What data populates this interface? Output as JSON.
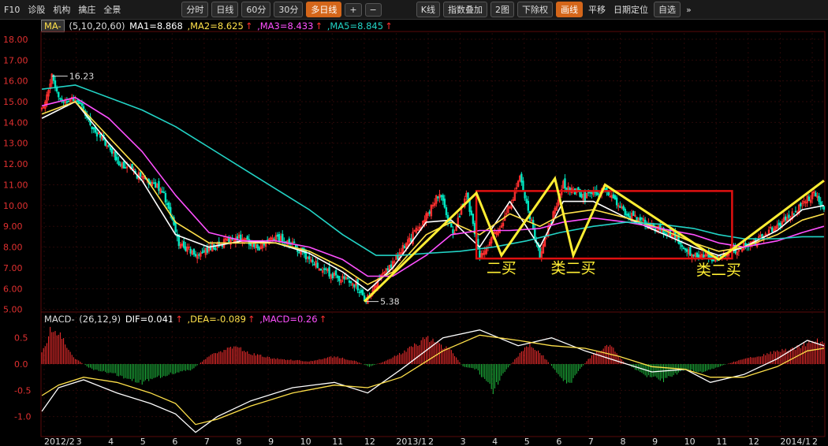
{
  "toolbar": {
    "left_items": [
      "F10",
      "诊股",
      "机构",
      "擒庄",
      "全景"
    ],
    "period_buttons": [
      "分时",
      "日线",
      "60分",
      "30分"
    ],
    "active_period": "多日线",
    "period_extra": [
      "+",
      "−"
    ],
    "right_buttons": [
      "K线",
      "指数叠加",
      "2图",
      "下除权",
      "画线"
    ],
    "right_items": [
      "平移",
      "日期定位",
      "自选"
    ],
    "far_right": "»"
  },
  "ma_legend": {
    "name": "MA-",
    "params": "(5,10,20,60)",
    "ma1": "MA1=8.868",
    "ma2": ",MA2=8.625",
    "ma3": ",MA3=8.433",
    "ma5": ",MA5=8.845",
    "arrow": "↑"
  },
  "macd_legend": {
    "name": "MACD-",
    "params": "(26,12,9)",
    "dif": "DIF=0.041",
    "dea": ",DEA=-0.089",
    "macd": ",MACD=0.26",
    "arrow": "↑"
  },
  "colors": {
    "up": "#ff3030",
    "down": "#00e5c0",
    "ma1": "#ffffff",
    "ma2": "#ffe14a",
    "ma3": "#ff50ff",
    "ma5": "#22d3c5",
    "annotation": "#ffee33",
    "box": "#e01010",
    "axis_text": "#e03030"
  },
  "chart_data": [
    {
      "type": "candlestick",
      "title": "",
      "y_ticks": [
        5.0,
        6.0,
        7.0,
        8.0,
        9.0,
        10.0,
        11.0,
        12.0,
        13.0,
        14.0,
        15.0,
        16.0,
        17.0,
        18.0
      ],
      "y_tick_labels": [
        "5.00",
        "6.00",
        "7.00",
        "8.00",
        "9.00",
        "10.00",
        "11.00",
        "12.00",
        "13.00",
        "14.00",
        "15.00",
        "16.00",
        "17.00",
        "18.00"
      ],
      "ylim": [
        4.95,
        18.3
      ],
      "x_labels": [
        "2012/2",
        "3",
        "4",
        "5",
        "6",
        "7",
        "8",
        "9",
        "10",
        "11",
        "12",
        "2013/1",
        "2",
        "3",
        "4",
        "5",
        "6",
        "7",
        "8",
        "9",
        "10",
        "11",
        "12",
        "2014/1",
        "2"
      ],
      "price_path": [
        [
          0,
          14.6
        ],
        [
          6,
          16.2
        ],
        [
          12,
          15.0
        ],
        [
          20,
          15.2
        ],
        [
          30,
          13.8
        ],
        [
          45,
          12.2
        ],
        [
          60,
          11.3
        ],
        [
          72,
          10.8
        ],
        [
          82,
          8.2
        ],
        [
          92,
          7.6
        ],
        [
          105,
          8.1
        ],
        [
          118,
          8.5
        ],
        [
          130,
          8.0
        ],
        [
          140,
          8.5
        ],
        [
          150,
          8.1
        ],
        [
          162,
          7.3
        ],
        [
          175,
          6.6
        ],
        [
          188,
          6.2
        ],
        [
          193,
          5.38
        ],
        [
          200,
          6.2
        ],
        [
          215,
          7.8
        ],
        [
          228,
          9.2
        ],
        [
          238,
          10.6
        ],
        [
          246,
          8.6
        ],
        [
          254,
          10.6
        ],
        [
          262,
          7.6
        ],
        [
          276,
          9.2
        ],
        [
          286,
          11.3
        ],
        [
          298,
          7.6
        ],
        [
          312,
          11.0
        ],
        [
          325,
          10.4
        ],
        [
          337,
          10.8
        ],
        [
          350,
          9.6
        ],
        [
          365,
          9.0
        ],
        [
          378,
          8.6
        ],
        [
          390,
          7.6
        ],
        [
          402,
          7.5
        ],
        [
          412,
          7.8
        ],
        [
          425,
          8.2
        ],
        [
          440,
          9.0
        ],
        [
          452,
          9.8
        ],
        [
          462,
          10.6
        ],
        [
          468,
          9.8
        ]
      ],
      "series": [
        {
          "name": "MA1",
          "points": [
            [
              0,
              14.2
            ],
            [
              20,
              15.0
            ],
            [
              40,
              13.0
            ],
            [
              60,
              11.2
            ],
            [
              80,
              8.6
            ],
            [
              100,
              8.0
            ],
            [
              120,
              8.3
            ],
            [
              140,
              8.2
            ],
            [
              160,
              7.7
            ],
            [
              180,
              6.8
            ],
            [
              195,
              5.9
            ],
            [
              210,
              7.0
            ],
            [
              230,
              9.2
            ],
            [
              245,
              9.3
            ],
            [
              262,
              8.0
            ],
            [
              280,
              10.2
            ],
            [
              298,
              8.0
            ],
            [
              312,
              10.2
            ],
            [
              330,
              10.2
            ],
            [
              350,
              9.4
            ],
            [
              370,
              8.7
            ],
            [
              390,
              8.0
            ],
            [
              405,
              7.6
            ],
            [
              420,
              8.0
            ],
            [
              440,
              8.8
            ],
            [
              455,
              9.8
            ],
            [
              468,
              10.0
            ]
          ]
        },
        {
          "name": "MA2",
          "points": [
            [
              0,
              14.4
            ],
            [
              20,
              15.0
            ],
            [
              40,
              13.3
            ],
            [
              60,
              11.6
            ],
            [
              80,
              9.2
            ],
            [
              100,
              8.2
            ],
            [
              120,
              8.2
            ],
            [
              140,
              8.2
            ],
            [
              160,
              7.8
            ],
            [
              180,
              7.0
            ],
            [
              195,
              6.2
            ],
            [
              210,
              6.8
            ],
            [
              230,
              8.6
            ],
            [
              245,
              9.2
            ],
            [
              262,
              8.6
            ],
            [
              280,
              9.6
            ],
            [
              298,
              9.0
            ],
            [
              312,
              9.6
            ],
            [
              330,
              9.8
            ],
            [
              350,
              9.4
            ],
            [
              370,
              8.9
            ],
            [
              390,
              8.2
            ],
            [
              405,
              7.8
            ],
            [
              420,
              8.0
            ],
            [
              440,
              8.6
            ],
            [
              455,
              9.3
            ],
            [
              468,
              9.6
            ]
          ]
        },
        {
          "name": "MA3",
          "points": [
            [
              0,
              14.8
            ],
            [
              20,
              15.2
            ],
            [
              40,
              14.2
            ],
            [
              60,
              12.6
            ],
            [
              80,
              10.5
            ],
            [
              100,
              8.7
            ],
            [
              120,
              8.3
            ],
            [
              140,
              8.3
            ],
            [
              160,
              8.0
            ],
            [
              180,
              7.4
            ],
            [
              195,
              6.6
            ],
            [
              210,
              6.6
            ],
            [
              230,
              7.6
            ],
            [
              245,
              8.6
            ],
            [
              262,
              8.8
            ],
            [
              280,
              8.8
            ],
            [
              298,
              8.9
            ],
            [
              312,
              9.2
            ],
            [
              330,
              9.4
            ],
            [
              350,
              9.2
            ],
            [
              370,
              8.9
            ],
            [
              390,
              8.6
            ],
            [
              405,
              8.2
            ],
            [
              420,
              8.0
            ],
            [
              440,
              8.3
            ],
            [
              455,
              8.7
            ],
            [
              468,
              9.0
            ]
          ]
        },
        {
          "name": "MA5",
          "points": [
            [
              0,
              15.6
            ],
            [
              20,
              15.8
            ],
            [
              40,
              15.2
            ],
            [
              60,
              14.6
            ],
            [
              80,
              13.8
            ],
            [
              100,
              12.8
            ],
            [
              120,
              11.8
            ],
            [
              140,
              10.8
            ],
            [
              160,
              9.8
            ],
            [
              180,
              8.6
            ],
            [
              200,
              7.6
            ],
            [
              215,
              7.6
            ],
            [
              230,
              7.7
            ],
            [
              250,
              7.8
            ],
            [
              270,
              8.0
            ],
            [
              290,
              8.3
            ],
            [
              310,
              8.7
            ],
            [
              330,
              9.0
            ],
            [
              350,
              9.2
            ],
            [
              370,
              9.1
            ],
            [
              390,
              8.9
            ],
            [
              405,
              8.6
            ],
            [
              420,
              8.4
            ],
            [
              440,
              8.4
            ],
            [
              455,
              8.5
            ],
            [
              468,
              8.5
            ]
          ]
        }
      ],
      "annotations": {
        "high_label": "16.23",
        "high_value": 16.23,
        "low_label": "5.38",
        "low_value": 5.38,
        "zigzag": [
          [
            193,
            5.38
          ],
          [
            260,
            10.6
          ],
          [
            275,
            7.6
          ],
          [
            307,
            11.3
          ],
          [
            318,
            7.6
          ],
          [
            337,
            11.0
          ],
          [
            405,
            7.4
          ],
          [
            468,
            11.2
          ]
        ],
        "box": {
          "x1": 260,
          "x2": 413,
          "y_high": 10.7,
          "y_low": 7.45
        },
        "texts": [
          {
            "text": "二买",
            "x": 275,
            "y": 6.75
          },
          {
            "text": "类二买",
            "x": 318,
            "y": 6.75
          },
          {
            "text": "类二买",
            "x": 405,
            "y": 6.65
          }
        ]
      }
    },
    {
      "type": "macd",
      "title": "",
      "y_ticks": [
        0.5,
        0.0,
        -0.5,
        -1.0
      ],
      "y_tick_labels": [
        "0.5",
        "0.0",
        "-0.5",
        "-1.0"
      ],
      "ylim": [
        -1.35,
        0.75
      ],
      "series": [
        {
          "name": "DIF",
          "points": [
            [
              0,
              -0.9
            ],
            [
              10,
              -0.45
            ],
            [
              25,
              -0.3
            ],
            [
              45,
              -0.55
            ],
            [
              65,
              -0.75
            ],
            [
              80,
              -0.95
            ],
            [
              92,
              -1.3
            ],
            [
              105,
              -1.0
            ],
            [
              125,
              -0.7
            ],
            [
              150,
              -0.45
            ],
            [
              175,
              -0.35
            ],
            [
              195,
              -0.55
            ],
            [
              215,
              -0.1
            ],
            [
              240,
              0.5
            ],
            [
              262,
              0.65
            ],
            [
              285,
              0.35
            ],
            [
              305,
              0.5
            ],
            [
              325,
              0.25
            ],
            [
              345,
              0.05
            ],
            [
              365,
              -0.15
            ],
            [
              385,
              -0.1
            ],
            [
              400,
              -0.35
            ],
            [
              420,
              -0.2
            ],
            [
              440,
              0.1
            ],
            [
              458,
              0.45
            ],
            [
              468,
              0.35
            ]
          ]
        },
        {
          "name": "DEA",
          "points": [
            [
              0,
              -0.6
            ],
            [
              10,
              -0.4
            ],
            [
              25,
              -0.25
            ],
            [
              45,
              -0.35
            ],
            [
              65,
              -0.55
            ],
            [
              80,
              -0.75
            ],
            [
              92,
              -1.15
            ],
            [
              105,
              -1.05
            ],
            [
              125,
              -0.8
            ],
            [
              150,
              -0.55
            ],
            [
              175,
              -0.4
            ],
            [
              195,
              -0.45
            ],
            [
              215,
              -0.25
            ],
            [
              240,
              0.25
            ],
            [
              262,
              0.55
            ],
            [
              285,
              0.45
            ],
            [
              305,
              0.35
            ],
            [
              325,
              0.3
            ],
            [
              345,
              0.15
            ],
            [
              365,
              -0.05
            ],
            [
              385,
              -0.1
            ],
            [
              400,
              -0.25
            ],
            [
              420,
              -0.25
            ],
            [
              440,
              -0.05
            ],
            [
              458,
              0.25
            ],
            [
              468,
              0.3
            ]
          ]
        }
      ],
      "histogram_path": [
        [
          0,
          0.2
        ],
        [
          6,
          0.7
        ],
        [
          12,
          0.5
        ],
        [
          20,
          0.1
        ],
        [
          30,
          -0.1
        ],
        [
          45,
          -0.2
        ],
        [
          60,
          -0.35
        ],
        [
          75,
          -0.2
        ],
        [
          90,
          -0.1
        ],
        [
          100,
          0.15
        ],
        [
          115,
          0.35
        ],
        [
          125,
          0.2
        ],
        [
          140,
          0.1
        ],
        [
          160,
          0.05
        ],
        [
          175,
          0.15
        ],
        [
          188,
          0.05
        ],
        [
          196,
          -0.05
        ],
        [
          205,
          0.05
        ],
        [
          215,
          0.2
        ],
        [
          230,
          0.5
        ],
        [
          245,
          0.25
        ],
        [
          252,
          -0.05
        ],
        [
          260,
          -0.1
        ],
        [
          270,
          -0.5
        ],
        [
          278,
          -0.1
        ],
        [
          285,
          0.15
        ],
        [
          292,
          0.4
        ],
        [
          300,
          0.15
        ],
        [
          308,
          -0.15
        ],
        [
          315,
          -0.4
        ],
        [
          322,
          -0.1
        ],
        [
          330,
          0.2
        ],
        [
          340,
          0.35
        ],
        [
          348,
          0.05
        ],
        [
          360,
          -0.2
        ],
        [
          372,
          -0.3
        ],
        [
          385,
          -0.1
        ],
        [
          395,
          -0.15
        ],
        [
          405,
          -0.05
        ],
        [
          420,
          0.1
        ],
        [
          435,
          0.2
        ],
        [
          450,
          0.3
        ],
        [
          462,
          0.45
        ],
        [
          468,
          0.4
        ]
      ]
    }
  ]
}
